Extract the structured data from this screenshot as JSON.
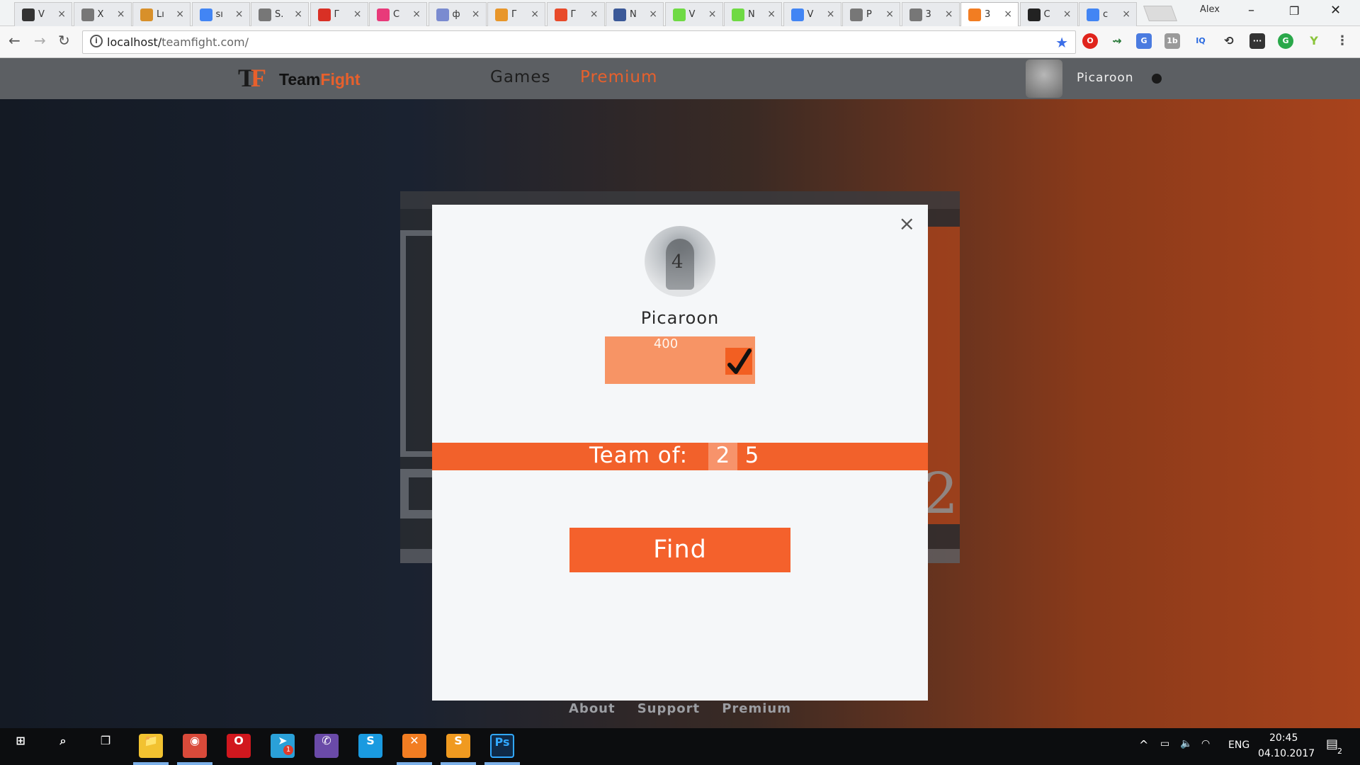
{
  "browser": {
    "tabs": [
      {
        "icon": "codepen-icon",
        "short": "V",
        "color": "#333"
      },
      {
        "icon": "page-icon",
        "short": "X",
        "color": "#777"
      },
      {
        "icon": "r-logo-icon",
        "short": "Lı",
        "color": "#d8902a"
      },
      {
        "icon": "google-icon",
        "short": "sı",
        "color": "#4285f4"
      },
      {
        "icon": "page-icon",
        "short": "S.",
        "color": "#777"
      },
      {
        "icon": "gmail-icon",
        "short": "Г",
        "color": "#d93025"
      },
      {
        "icon": "cee-icon",
        "short": "C",
        "color": "#e83a7a"
      },
      {
        "icon": "m-logo-icon",
        "short": "ф",
        "color": "#7a8bd0"
      },
      {
        "icon": "m-logo-icon",
        "short": "Г",
        "color": "#e8962a"
      },
      {
        "icon": "yr-logo-icon",
        "short": "Г",
        "color": "#e84a2a"
      },
      {
        "icon": "facebook-icon",
        "short": "N",
        "color": "#3b5998"
      },
      {
        "icon": "upwork-icon",
        "short": "V",
        "color": "#6fda44"
      },
      {
        "icon": "upwork-icon",
        "short": "N",
        "color": "#6fda44"
      },
      {
        "icon": "google-icon",
        "short": "V",
        "color": "#4285f4"
      },
      {
        "icon": "quora-icon",
        "short": "P",
        "color": "#777"
      },
      {
        "icon": "page-icon",
        "short": "3",
        "color": "#777"
      },
      {
        "icon": "xampp-icon",
        "short": "3",
        "color": "#f27d22"
      },
      {
        "icon": "steam-icon",
        "short": "C",
        "color": "#222"
      },
      {
        "icon": "google-icon",
        "short": "c",
        "color": "#4285f4"
      }
    ],
    "profile_name": "Alex",
    "url_host": "localhost/",
    "url_path": "teamfight.com/"
  },
  "site": {
    "logo_mark": "TF",
    "logo_team": "Team",
    "logo_fight": "Fight",
    "nav": [
      {
        "label": "Games",
        "color": "#1e1e1e"
      },
      {
        "label": "Premium",
        "color": "#e8602c"
      }
    ],
    "username": "Picaroon",
    "footer": [
      "About",
      "Support",
      "Premium"
    ],
    "bg_digit": "2"
  },
  "modal": {
    "close": "×",
    "avatar_number": "4",
    "username": "Picaroon",
    "rating_value": "400",
    "team_label": "Team of:",
    "team_options": [
      {
        "label": "2",
        "selected": true
      },
      {
        "label": "5",
        "selected": false
      }
    ],
    "find_label": "Find"
  },
  "taskbar": {
    "apps": [
      {
        "icon": "windows-start-icon",
        "label": "⊞"
      },
      {
        "icon": "search-icon",
        "label": "⌕"
      },
      {
        "icon": "task-view-icon",
        "label": "❐"
      },
      {
        "icon": "file-explorer-icon",
        "label": "📁"
      },
      {
        "icon": "chrome-icon",
        "label": "◉"
      },
      {
        "icon": "opera-icon",
        "label": "O"
      },
      {
        "icon": "telegram-icon",
        "label": "➤"
      },
      {
        "icon": "viber-icon",
        "label": "✆"
      },
      {
        "icon": "skype-icon",
        "label": "S"
      },
      {
        "icon": "xampp-icon",
        "label": "✕"
      },
      {
        "icon": "sublime-icon",
        "label": "S"
      },
      {
        "icon": "photoshop-icon",
        "label": "Ps"
      }
    ],
    "telegram_badge": "1",
    "language": "ENG",
    "time": "20:45",
    "date": "04.10.2017",
    "notifications": "2"
  },
  "colors": {
    "accent": "#f2612b",
    "accent_light": "#f79465",
    "modal_bg": "#f5f7f9",
    "nav_bg": "#5c5f63"
  }
}
